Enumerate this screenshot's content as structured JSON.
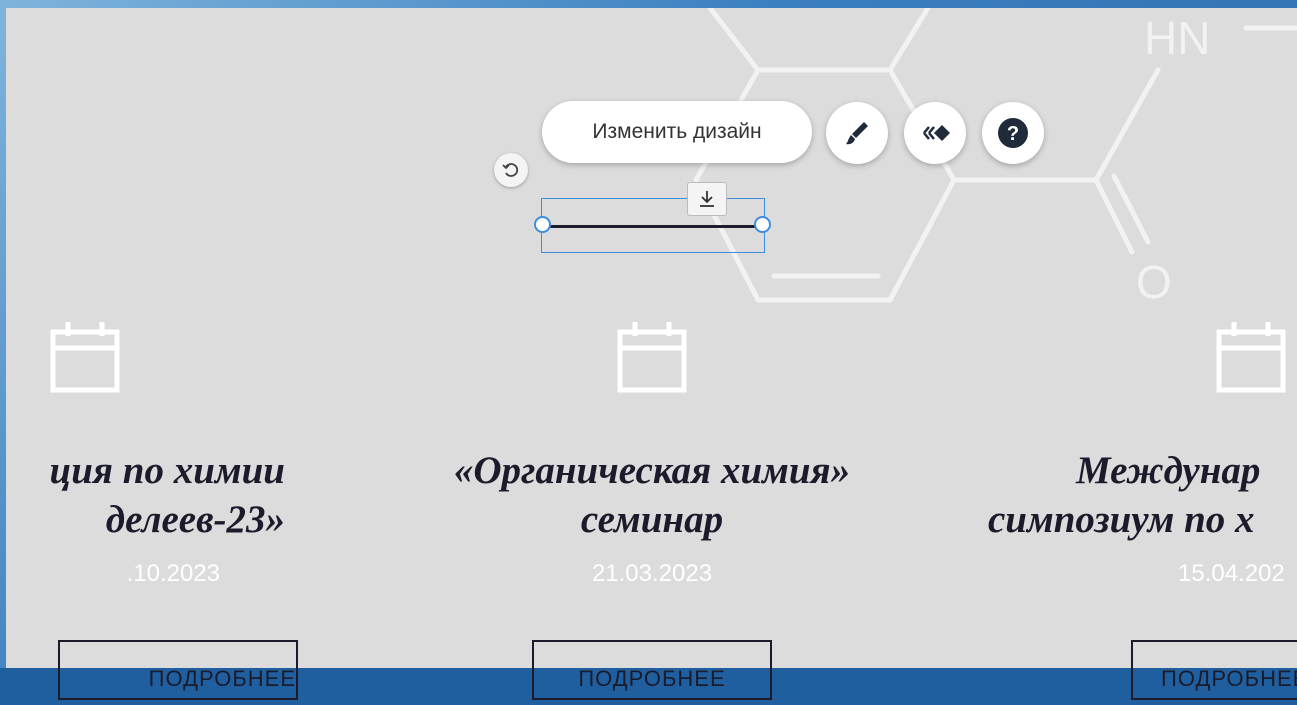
{
  "editor": {
    "change_design_label": "Изменить дизайн",
    "icons": {
      "brush": "brush-icon",
      "animation": "animation-icon",
      "help": "help-icon",
      "rotate": "rotate-icon",
      "anchor": "download-anchor-icon"
    }
  },
  "background": {
    "molecule_labels": [
      "HN",
      "O"
    ]
  },
  "events": [
    {
      "title_lines": [
        "ция по химии",
        "делеев-23»"
      ],
      "date": ".10.2023",
      "button_label": "ПОДРОБНЕЕ"
    },
    {
      "title_lines": [
        "«Органическая химия»",
        "семинар"
      ],
      "date": "21.03.2023",
      "button_label": "ПОДРОБНЕЕ"
    },
    {
      "title_lines": [
        "Междунар",
        "симпозиум по х"
      ],
      "date": "15.04.202",
      "button_label": "ПОДРОБНЕЕ"
    }
  ],
  "colors": {
    "panel_bg": "#dcdcdc",
    "selection_accent": "#3b8ee0",
    "title_text": "#1b1b2b",
    "date_text": "#ffffff"
  }
}
